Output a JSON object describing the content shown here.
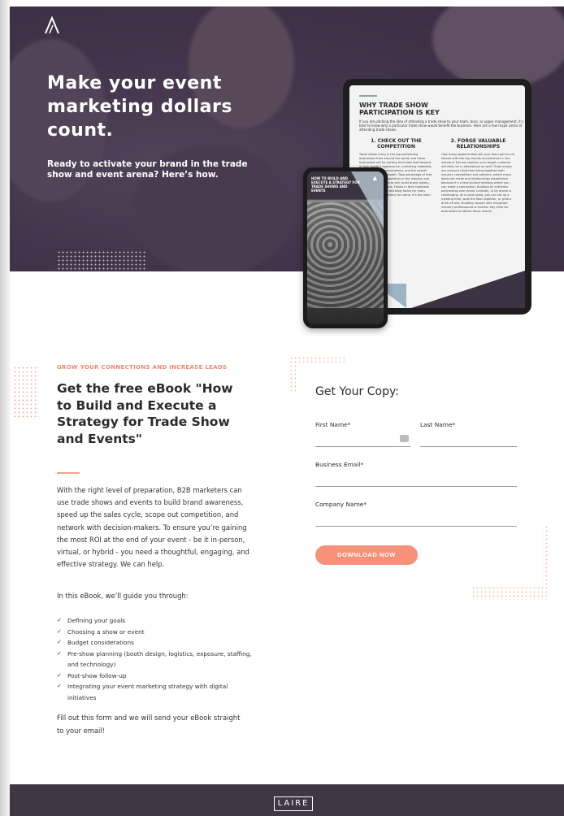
{
  "hero": {
    "title": "Make your event marketing dollars count.",
    "subtitle": "Ready to activate your brand in the trade show and event arena? Here’s how."
  },
  "tablet": {
    "title": "WHY TRADE SHOW PARTICIPATION IS KEY",
    "intro": "If you are pitching the idea of attending a trade show to your team, boss, or upper management, it’s best to know why a particular trade show would benefit the business. Here are a few major perks of attending trade shows.",
    "col1_heading": "1. CHECK OUT THE COMPETITION",
    "col1_text": "Trade shows bring in the top-performing businesses from around the world, and these businesses will be putting their best foot forward in their booth’s appearance, marketing materials, sales pitches, demonstrations, and the overall experience at their booth. Take advantage of that exposure to top competitors in the industry and learn their strategies to sell, build brand loyalty, and make connections. Follow in their footsteps away! This can be a deciding factor for many when choosing to attend; for some, it’s the main reason they go.",
    "col2_heading": "2. FORGE VALUABLE RELATIONSHIPS",
    "col2_text": "How many opportunities will your team get to rub elbows with the top brands and partners in the industry? Did we mention your target customer will likely be in attendance as well? Trade shows are unique in that they bring together both industry competitors and partners, where many deals are made and relationships established because it’s a face-to-face meeting where you can make a connection. Building an authentic partnership over email, LinkedIn, or by phone is challenging. At a trade show, you can set up a meeting time, walk the floor together, or grab a drink off-site. Building rapport with important industry professionals is another key pillar for businesses to attend these events."
  },
  "phone": {
    "title": "HOW TO BUILD AND EXECUTE A STRATEGY FOR TRADE SHOWS AND EVENTS"
  },
  "content": {
    "kicker": "GROW YOUR CONNECTIONS AND INCREASE LEADS",
    "ebook_title": "Get the free eBook \"How to Build and Execute a Strategy for Trade Show and Events\"",
    "body": "With the right level of preparation, B2B marketers can use trade shows and events to build brand awareness, speed up the sales cycle, scope out competition, and network with decision-makers. To ensure you’re gaining the most ROI at the end of your event - be it in-person, virtual, or hybrid - you need a thoughtful, engaging, and effective strategy. We can help.",
    "guide_intro": "In this eBook, we’ll guide you through:",
    "checklist": [
      "Defining your goals",
      "Choosing a show or event",
      "Budget considerations",
      "Pre-show planning (booth design, logistics, exposure, staffing, and technology)",
      "Post-show follow-up",
      "Integrating your event marketing strategy with digital initiatives"
    ],
    "closing": "Fill out this form and we will send your eBook straight to your email!"
  },
  "form": {
    "title": "Get Your Copy:",
    "first_name_label": "First Name*",
    "last_name_label": "Last Name*",
    "email_label": "Business Email*",
    "company_label": "Company Name*",
    "submit_label": "DOWNLOAD NOW"
  },
  "footer": {
    "logo_text": "LAIRE"
  },
  "colors": {
    "accent": "#f79279",
    "dark": "#3f3744"
  }
}
